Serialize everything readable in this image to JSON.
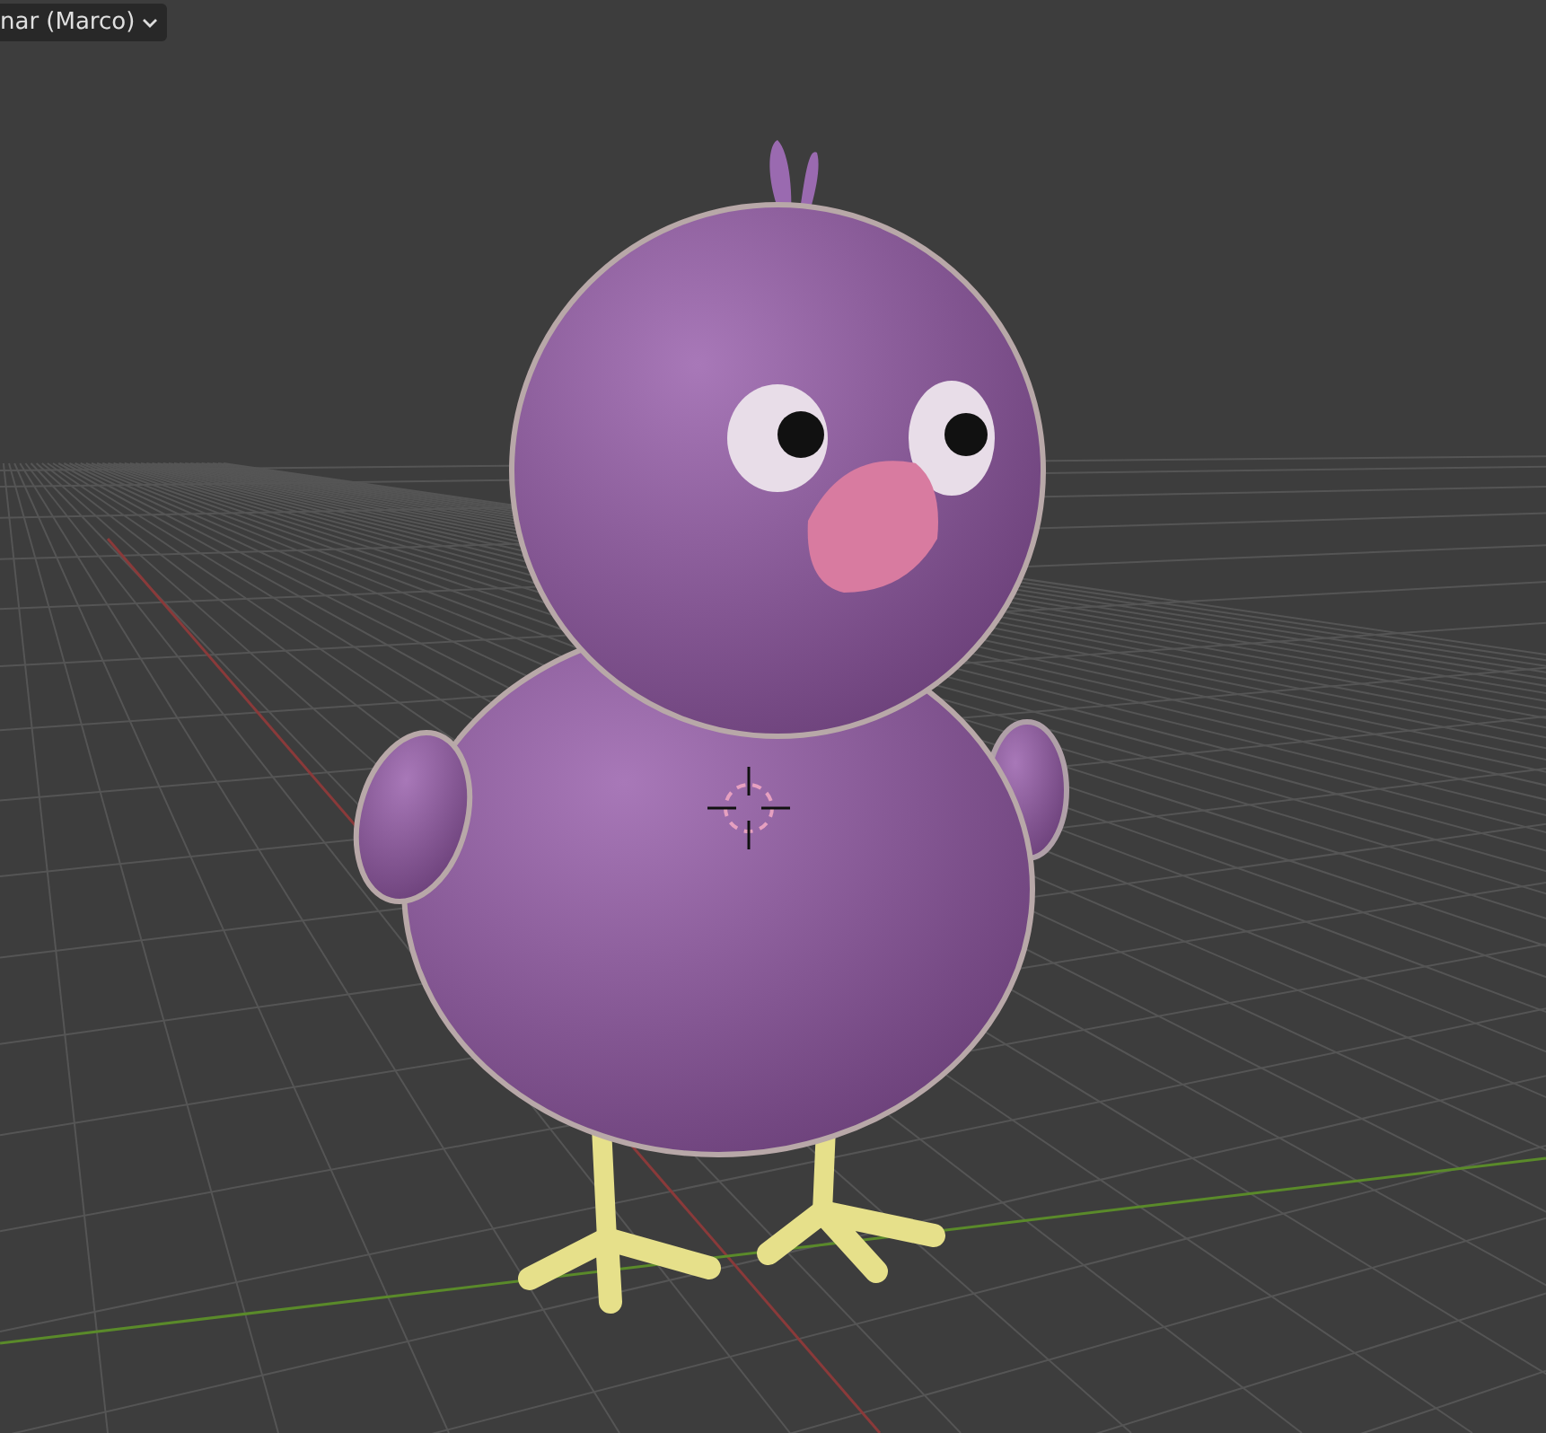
{
  "viewport": {
    "object_menu": {
      "label": "nar (Marco)"
    }
  }
}
